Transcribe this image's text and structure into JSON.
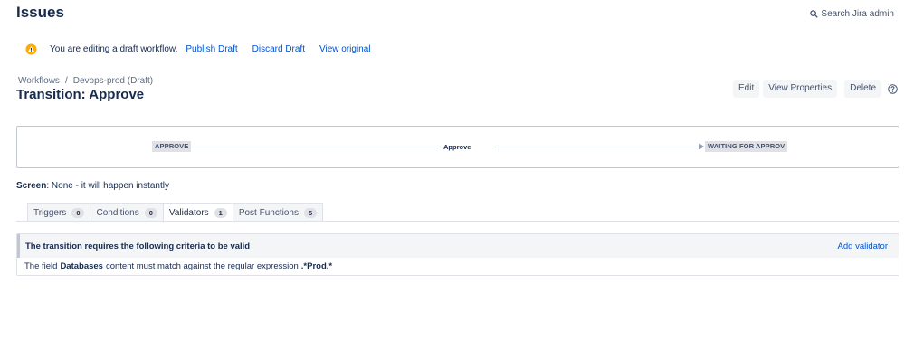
{
  "header": {
    "title": "Issues",
    "search_label": "Search Jira admin"
  },
  "draft_banner": {
    "message": "You are editing a draft workflow.",
    "publish_label": "Publish Draft",
    "discard_label": "Discard Draft",
    "view_original_label": "View original",
    "icon": "warning-icon"
  },
  "breadcrumb": {
    "items": [
      "Workflows",
      "/",
      "Devops-prod (Draft)"
    ]
  },
  "transition": {
    "title": "Transition: Approve",
    "name": "Approve",
    "from_status": "APPROVE",
    "to_status": "WAITING FOR APPROV"
  },
  "actions": {
    "edit_label": "Edit",
    "view_properties_label": "View Properties",
    "delete_label": "Delete",
    "help_icon": "help-icon"
  },
  "screen": {
    "label": "Screen",
    "value": ": None - it will happen instantly"
  },
  "tabs": [
    {
      "label": "Triggers",
      "count": "0"
    },
    {
      "label": "Conditions",
      "count": "0"
    },
    {
      "label": "Validators",
      "count": "1"
    },
    {
      "label": "Post Functions",
      "count": "5"
    }
  ],
  "validators": {
    "header": "The transition requires the following criteria to be valid",
    "add_label": "Add validator",
    "rule_prefix": "The field",
    "rule_field": "Databases",
    "rule_middle": "content must match against the regular expression",
    "rule_regex": ".*Prod.*"
  },
  "colors": {
    "link": "#0052cc",
    "title": "#172b4d",
    "warning": "#ffab00"
  }
}
